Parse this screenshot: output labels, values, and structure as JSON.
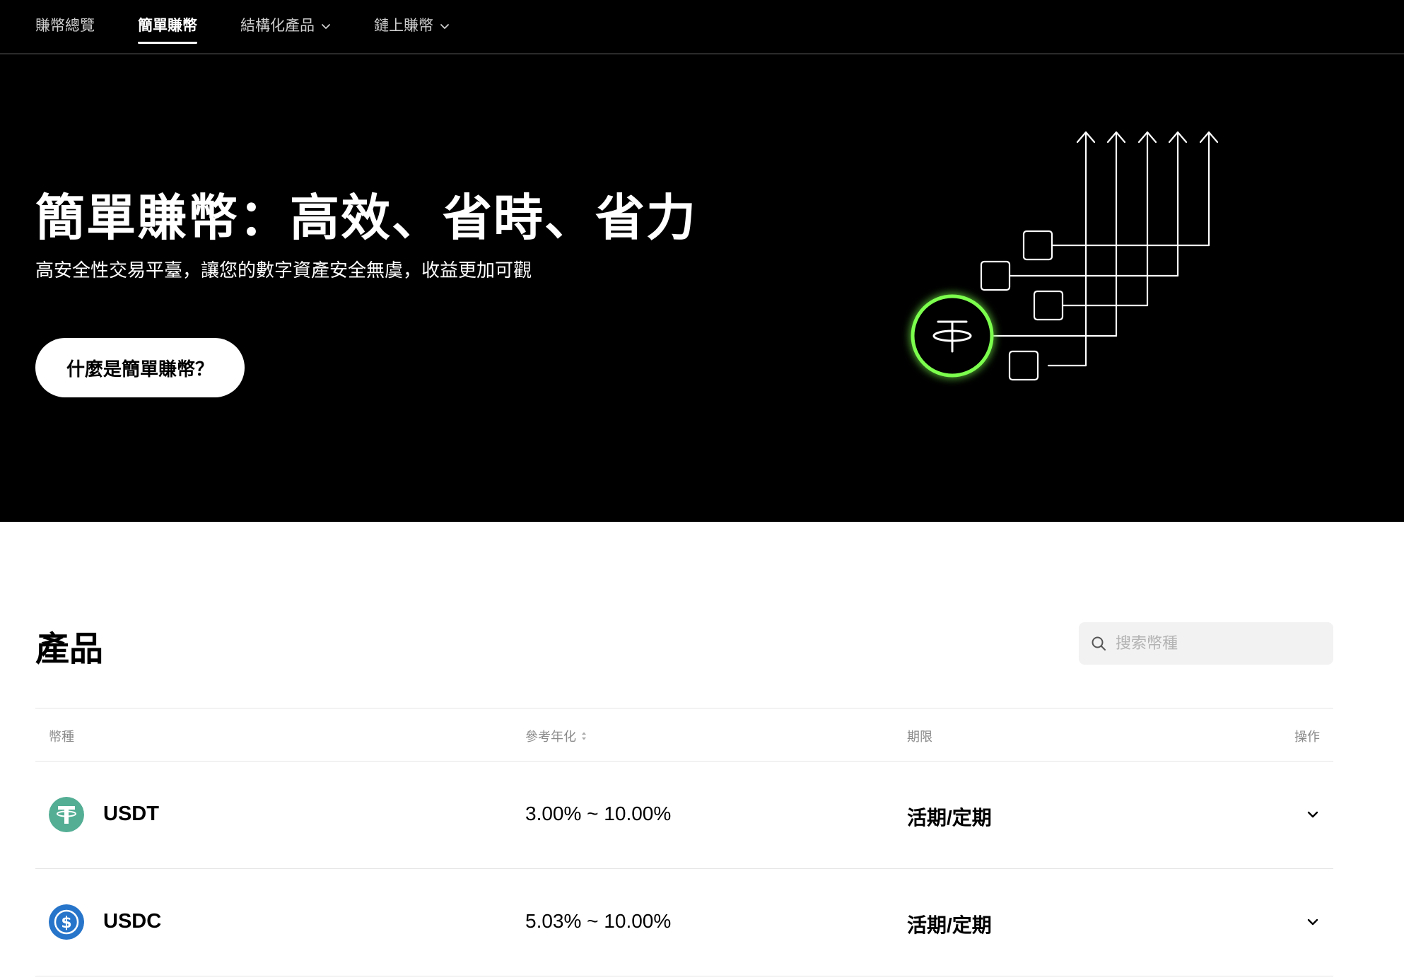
{
  "nav": {
    "items": [
      {
        "label": "賺幣總覽",
        "active": false,
        "dropdown": false
      },
      {
        "label": "簡單賺幣",
        "active": true,
        "dropdown": false
      },
      {
        "label": "結構化產品",
        "active": false,
        "dropdown": true
      },
      {
        "label": "鏈上賺幣",
        "active": false,
        "dropdown": true
      }
    ]
  },
  "hero": {
    "title": "簡單賺幣：高效、省時、省力",
    "subtitle": "高安全性交易平臺，讓您的數字資產安全無虞，收益更加可觀",
    "button_label": "什麼是簡單賺幣？",
    "accent_color": "#7CFF4D"
  },
  "products": {
    "title": "產品",
    "search_placeholder": "搜索幣種",
    "columns": {
      "coin": "幣種",
      "apy": "參考年化",
      "term": "期限",
      "action": "操作"
    },
    "rows": [
      {
        "coin": "USDT",
        "icon": "usdt-icon",
        "icon_color": "#53AE94",
        "apy": "3.00% ~ 10.00%",
        "term": "活期/定期"
      },
      {
        "coin": "USDC",
        "icon": "usdc-icon",
        "icon_color": "#2775CA",
        "apy": "5.03% ~ 10.00%",
        "term": "活期/定期"
      }
    ]
  }
}
